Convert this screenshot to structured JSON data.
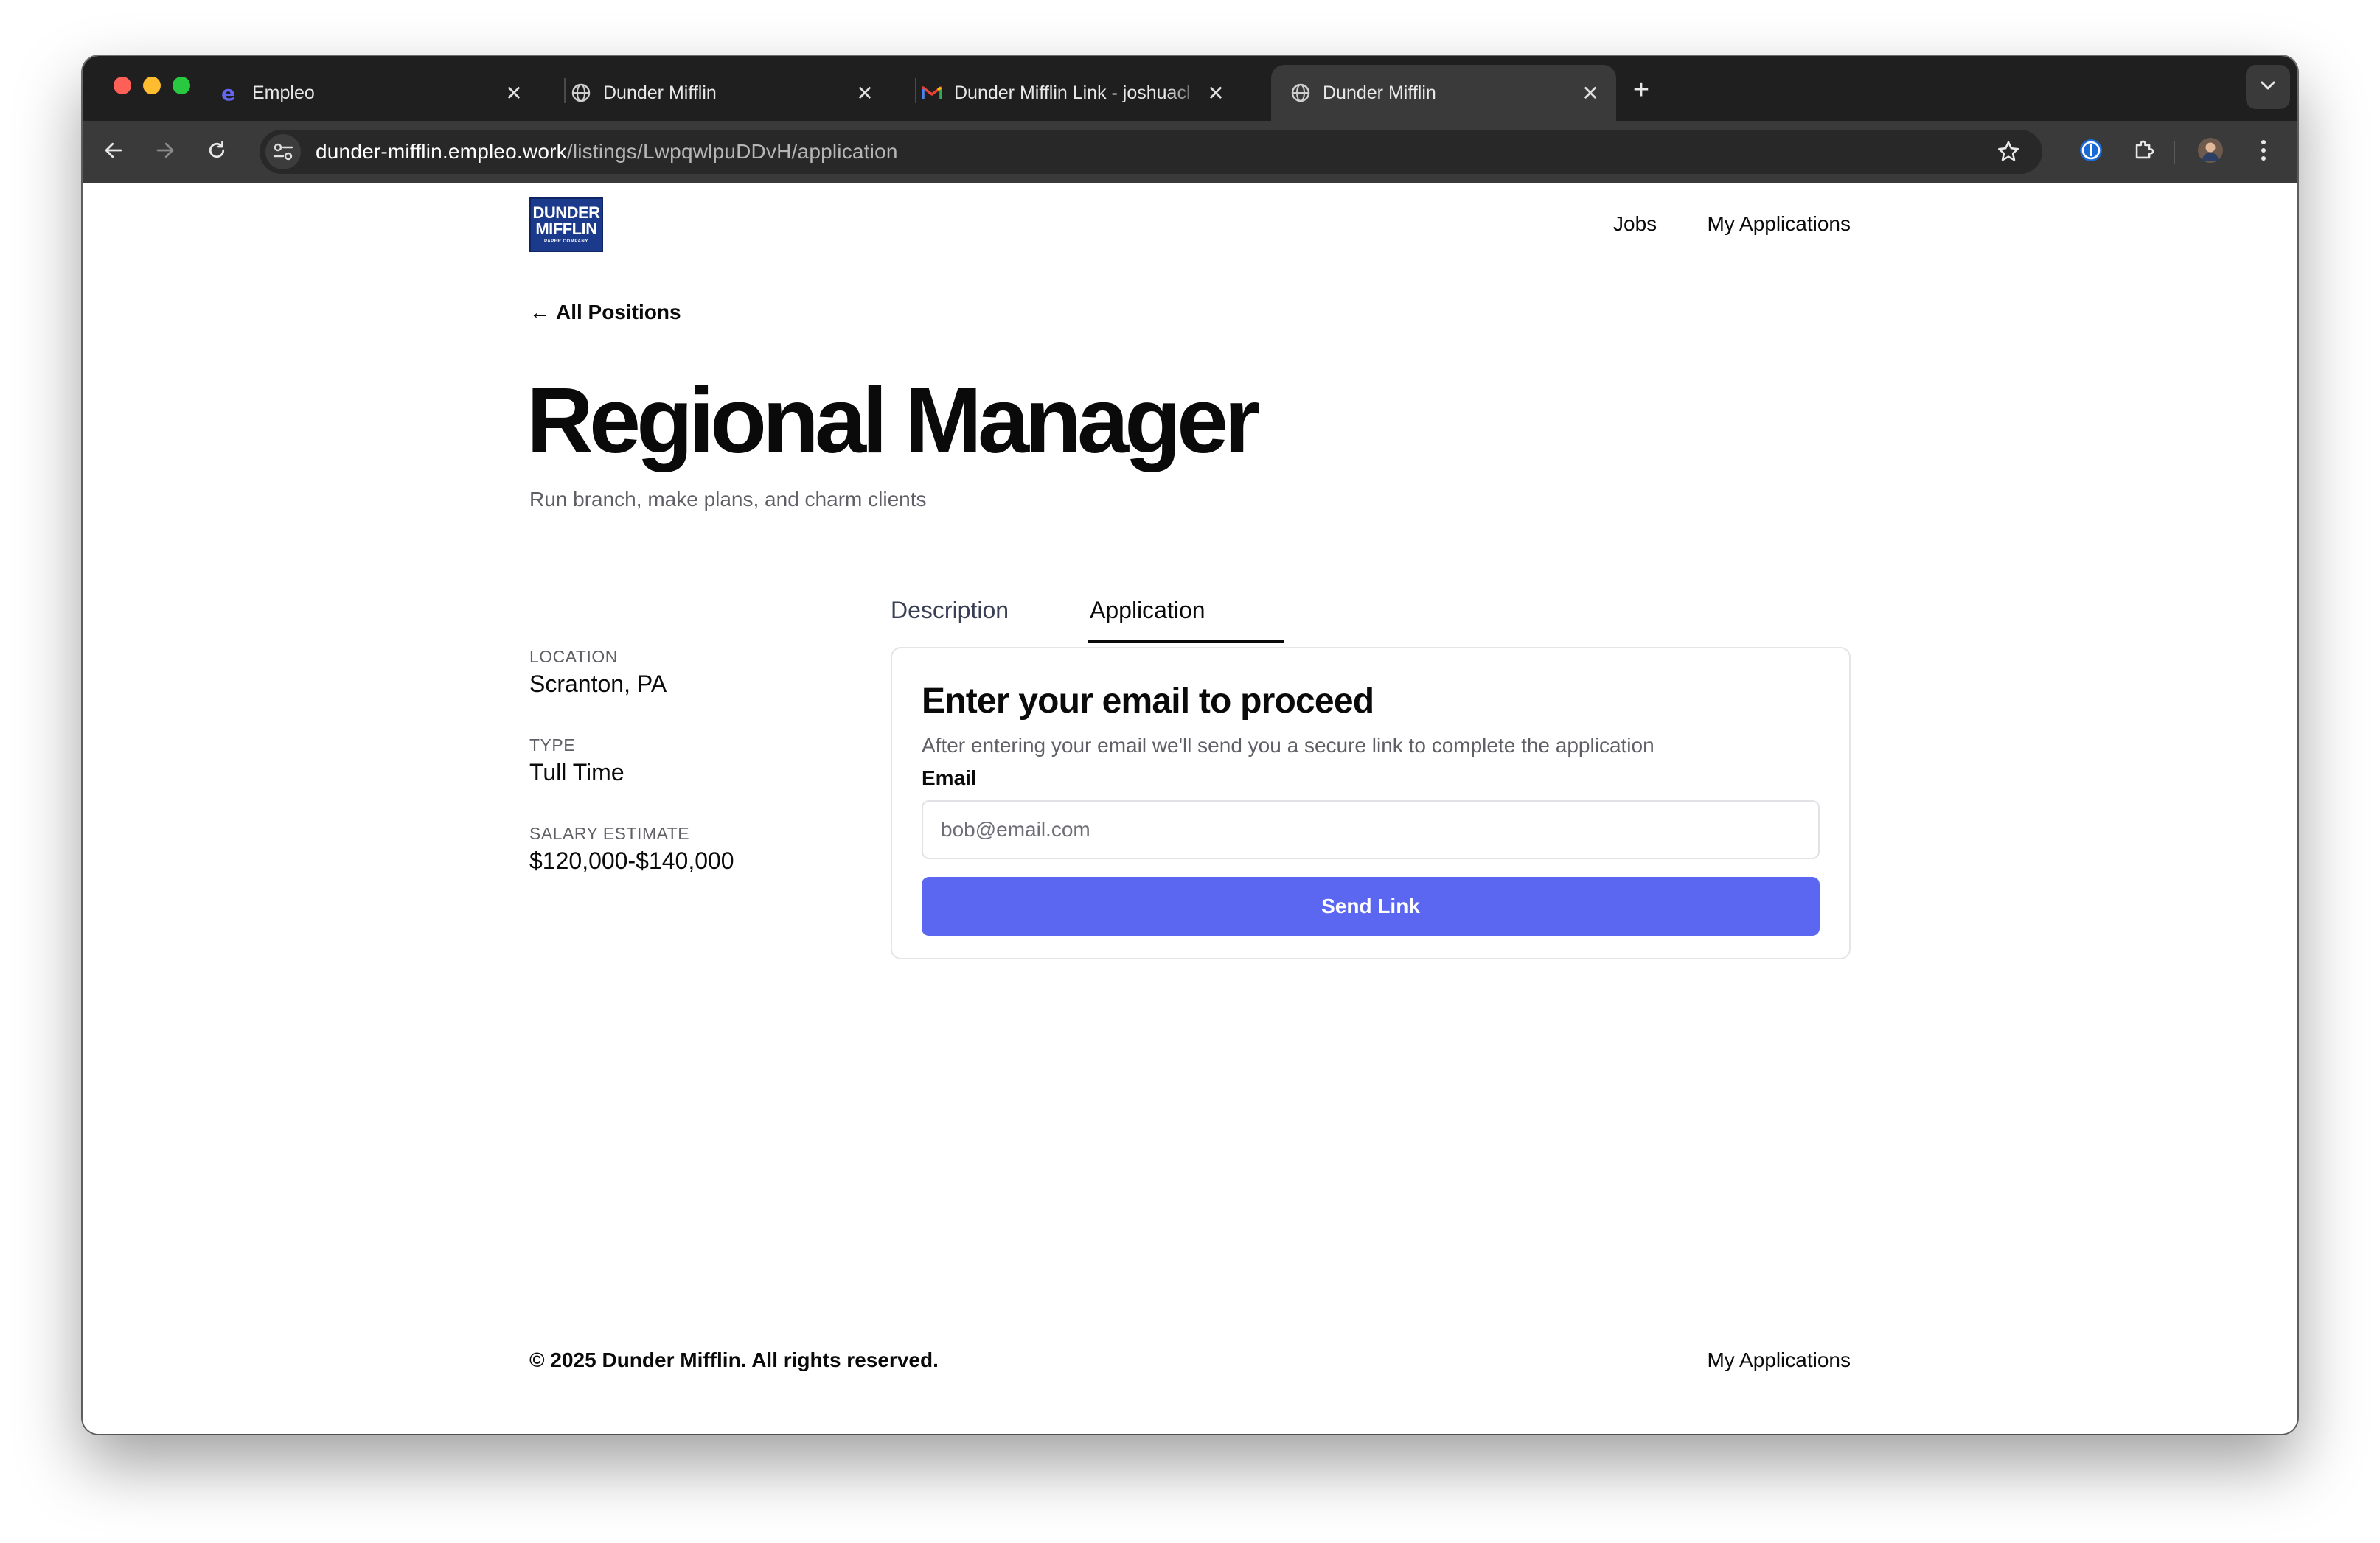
{
  "browser": {
    "tabs": [
      {
        "title": "Empleo",
        "favicon": "empleo-e-icon"
      },
      {
        "title": "Dunder Mifflin",
        "favicon": "globe-icon"
      },
      {
        "title": "Dunder Mifflin Link - joshuacl",
        "favicon": "gmail-icon"
      },
      {
        "title": "Dunder Mifflin",
        "favicon": "globe-icon",
        "active": true
      }
    ],
    "url_host": "dunder-mifflin.empleo.work",
    "url_path": "/listings/LwpqwlpuDDvH/application",
    "close_glyph": "✕",
    "new_tab_glyph": "+"
  },
  "site": {
    "logo": {
      "line1": "DUNDER",
      "line2": "MIFFLIN",
      "line3": "PAPER COMPANY"
    },
    "nav": {
      "jobs": "Jobs",
      "my_applications": "My Applications"
    }
  },
  "listing": {
    "back_arrow": "←",
    "back_label": "All Positions",
    "title": "Regional Manager",
    "subtitle": "Run branch, make plans, and charm clients",
    "meta": {
      "location_label": "LOCATION",
      "location_value": "Scranton, PA",
      "type_label": "TYPE",
      "type_value": "Tull Time",
      "salary_label": "SALARY ESTIMATE",
      "salary_value": "$120,000-$140,000"
    },
    "tabs": {
      "description": "Description",
      "application": "Application",
      "active": "Application"
    }
  },
  "application_card": {
    "title": "Enter your email to proceed",
    "description": "After entering your email we'll send you a secure link to complete the application",
    "email_label": "Email",
    "email_placeholder": "bob@email.com",
    "email_value": "",
    "submit_label": "Send Link"
  },
  "footer": {
    "copyright": "© 2025 Dunder Mifflin. All rights reserved.",
    "my_applications": "My Applications"
  },
  "colors": {
    "accent": "#5b67f0",
    "logo_blue": "#1b3a8c",
    "tabstrip_bg": "#1f1f1f",
    "toolbar_bg": "#3a3a3a"
  }
}
